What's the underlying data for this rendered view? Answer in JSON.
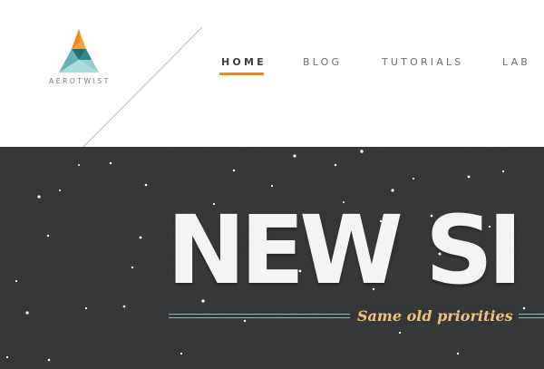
{
  "brand": {
    "name": "AEROTWIST",
    "colors": {
      "orange": "#f08a1c",
      "teal_dark": "#1f6f74",
      "teal_light": "#8fd1cf"
    }
  },
  "nav": {
    "items": [
      {
        "label": "HOME",
        "active": true
      },
      {
        "label": "BLOG",
        "active": false
      },
      {
        "label": "TUTORIALS",
        "active": false
      },
      {
        "label": "LAB",
        "active": false
      }
    ],
    "accent": "#f08a1c"
  },
  "hero": {
    "headline": "NEW SI",
    "tagline": "Same old priorities",
    "background": "#353637",
    "tagline_color": "#f2c17a",
    "rule_color": "#8fb9b4"
  }
}
